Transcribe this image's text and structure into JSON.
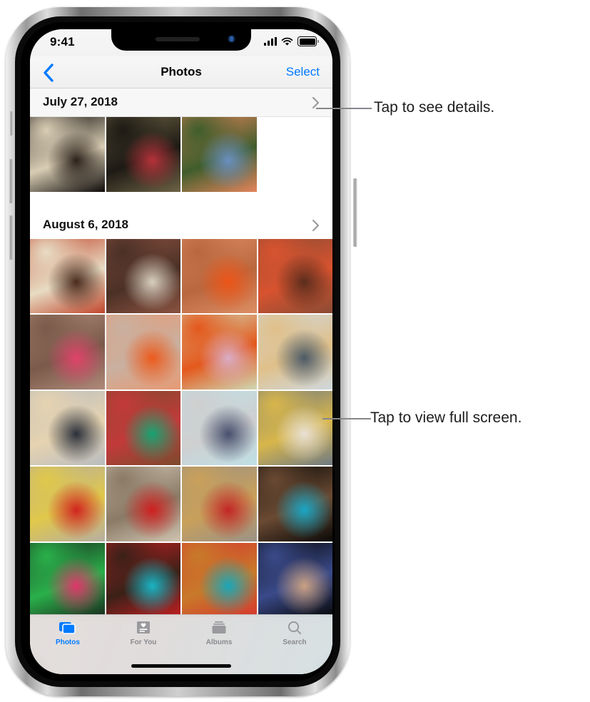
{
  "device": {
    "status_bar": {
      "time": "9:41",
      "icons": [
        "cellular-signal-icon",
        "wifi-icon",
        "battery-icon"
      ]
    },
    "home_indicator": true
  },
  "nav": {
    "back_icon": "chevron-left-icon",
    "title": "Photos",
    "select_label": "Select"
  },
  "sections": [
    {
      "date": "July 27, 2018",
      "disclosure_icon": "chevron-right-icon",
      "photos": [
        {
          "name": "silhouette-woman-by-window",
          "c1": "#0d0a08",
          "c2": "#2b211a",
          "c3": "#d9cdb4"
        },
        {
          "name": "woman-in-red-shirt-at-checkered-table",
          "c1": "#6d6245",
          "c2": "#b5323a",
          "c3": "#1d1a14"
        },
        {
          "name": "girl-in-blue-red-dress-on-steps",
          "c1": "#e4855c",
          "c2": "#6a8fbf",
          "c3": "#3f5d2b"
        }
      ]
    },
    {
      "date": "August 6, 2018",
      "disclosure_icon": "chevron-right-icon",
      "photos": [
        {
          "name": "woman-with-curly-hair-portrait",
          "c1": "#c0462c",
          "c2": "#4a2b1c",
          "c3": "#e8dcc4"
        },
        {
          "name": "man-in-patterned-robe-in-alley",
          "c1": "#8a5240",
          "c2": "#d8cfc0",
          "c3": "#4b3026"
        },
        {
          "name": "boy-in-orange-shirt-running",
          "c1": "#dd8e63",
          "c2": "#ec5518",
          "c3": "#b9673f"
        },
        {
          "name": "woman-in-red-dress-on-dune",
          "c1": "#8a4b34",
          "c2": "#5a2d1d",
          "c3": "#d8532f"
        },
        {
          "name": "woman-in-pink-dress-seated",
          "c1": "#b08a7a",
          "c2": "#e0436a",
          "c3": "#7a5a4a"
        },
        {
          "name": "boy-juggling-ball-orange-wall",
          "c1": "#e79a74",
          "c2": "#ec5a1c",
          "c3": "#c9b0a0"
        },
        {
          "name": "boy-juggling-balls-green-wall",
          "c1": "#cfd8b4",
          "c2": "#d9aec6",
          "c3": "#e4581c"
        },
        {
          "name": "man-in-striped-robe-at-sunset",
          "c1": "#cfd8dd",
          "c2": "#4b5a66",
          "c3": "#e0c08a"
        },
        {
          "name": "person-with-cloth-in-wind",
          "c1": "#b9bcc0",
          "c2": "#2a2f3a",
          "c3": "#e6d3b0"
        },
        {
          "name": "man-in-green-shirt-with-rugs",
          "c1": "#7c4a2e",
          "c2": "#16a472",
          "c3": "#c23a3a"
        },
        {
          "name": "elderly-man-with-flat-cap",
          "c1": "#bfe0e6",
          "c2": "#47506e",
          "c3": "#cfcfcf"
        },
        {
          "name": "smiling-girl-by-taxi",
          "c1": "#6f7a84",
          "c2": "#e8e0d4",
          "c3": "#d8b64a"
        },
        {
          "name": "woman-in-red-top-by-taxi",
          "c1": "#b6aea2",
          "c2": "#d0241f",
          "c3": "#e0c84a"
        },
        {
          "name": "smiling-woman-red-sweater",
          "c1": "#cfc4b0",
          "c2": "#cf2020",
          "c3": "#8a7a66"
        },
        {
          "name": "woman-in-embroidered-red-dress",
          "c1": "#9a9286",
          "c2": "#c22626",
          "c3": "#c9a05a"
        },
        {
          "name": "figure-in-blue-in-dark-archway",
          "c1": "#0a0806",
          "c2": "#1aa6c4",
          "c3": "#6a4a33"
        },
        {
          "name": "woman-with-colored-light-portrait",
          "c1": "#1a2a1e",
          "c2": "#e0356a",
          "c3": "#2ab04a"
        },
        {
          "name": "man-in-teal-robe-red-background",
          "c1": "#c41f22",
          "c2": "#19b4c4",
          "c3": "#3a2118"
        },
        {
          "name": "boy-in-teal-robe-red-textile",
          "c1": "#d6372e",
          "c2": "#1aa6b8",
          "c3": "#c87a2a"
        },
        {
          "name": "woman-profile-dark-background",
          "c1": "#070707",
          "c2": "#caa183",
          "c3": "#3a4a8a"
        }
      ]
    }
  ],
  "tabbar": {
    "items": [
      {
        "label": "Photos",
        "icon": "photos-stack-icon",
        "active": true
      },
      {
        "label": "For You",
        "icon": "for-you-heart-card-icon",
        "active": false
      },
      {
        "label": "Albums",
        "icon": "albums-icon",
        "active": false
      },
      {
        "label": "Search",
        "icon": "magnifying-glass-icon",
        "active": false
      }
    ],
    "active_color": "#007aff",
    "inactive_color": "#8a8a8e"
  },
  "callouts": [
    {
      "text": "Tap to see details.",
      "target": "date-header-disclosure"
    },
    {
      "text": "Tap to view full screen.",
      "target": "photo-grid-thumbnail"
    }
  ]
}
